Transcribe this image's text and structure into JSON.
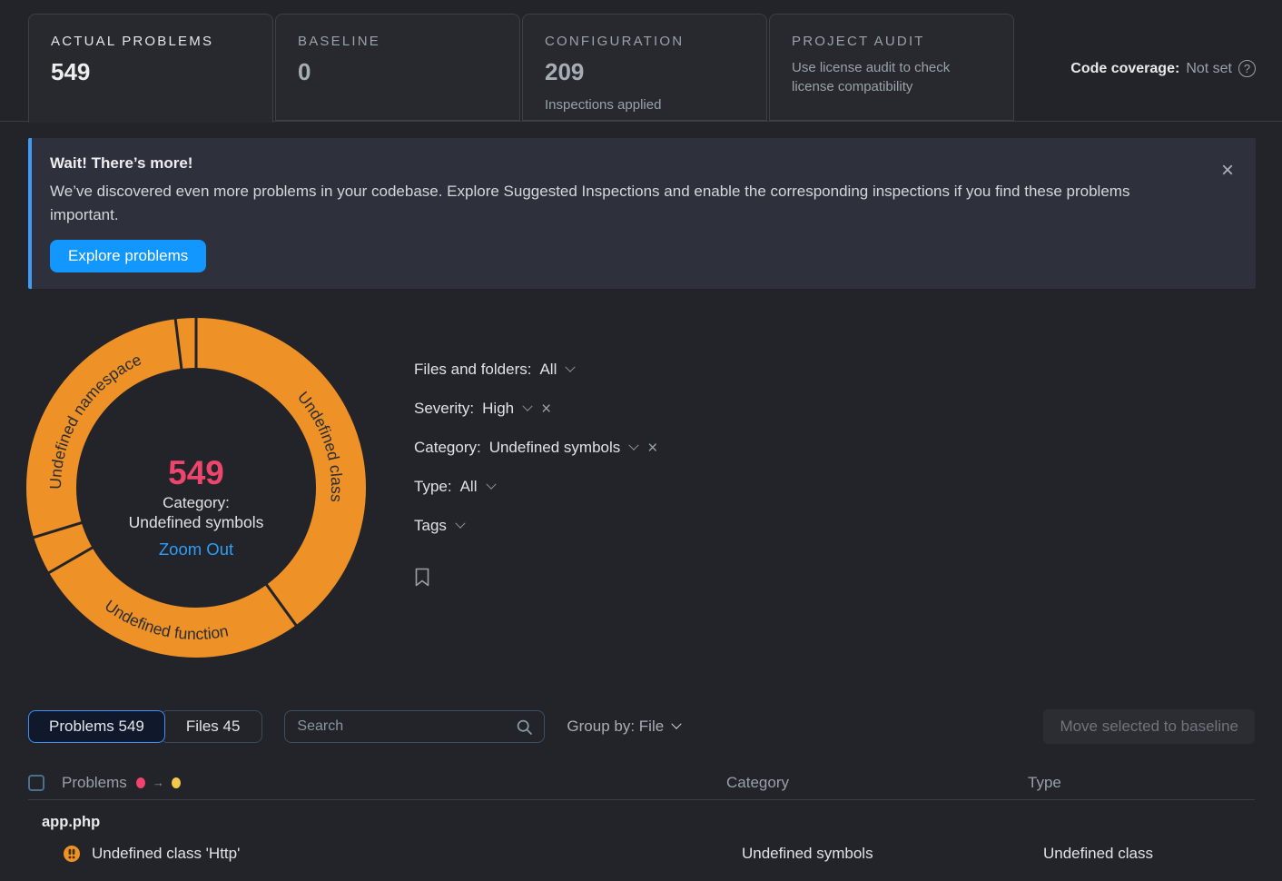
{
  "header": {
    "tabs": [
      {
        "label": "ACTUAL PROBLEMS",
        "value": "549"
      },
      {
        "label": "BASELINE",
        "value": "0"
      },
      {
        "label": "CONFIGURATION",
        "value": "209",
        "description": "Inspections applied"
      },
      {
        "label": "PROJECT AUDIT",
        "description": "Use license audit to check license compatibility"
      }
    ],
    "code_coverage": {
      "label": "Code coverage:",
      "value": "Not set",
      "help_icon": "?"
    }
  },
  "banner": {
    "title": "Wait! There’s more!",
    "body": "We’ve discovered even more problems in your codebase. Explore Suggested Inspections and enable the corresponding inspections if you find these problems important.",
    "button": "Explore problems",
    "close_icon": "×"
  },
  "chart_data": {
    "type": "donut",
    "unit": "problems",
    "total": 549,
    "segments": [
      {
        "label": "Undefined class",
        "value": 220,
        "start_deg": 0,
        "end_deg": 144
      },
      {
        "label": "Undefined function",
        "value": 146,
        "start_deg": 144,
        "end_deg": 240
      },
      {
        "label": "",
        "value": 20,
        "start_deg": 240,
        "end_deg": 253
      },
      {
        "label": "Undefined namespace",
        "value": 152,
        "start_deg": 253,
        "end_deg": 353
      },
      {
        "label": "",
        "value": 11,
        "start_deg": 353,
        "end_deg": 360
      }
    ],
    "center": {
      "value": "549",
      "label_line1": "Category:",
      "label_line2": "Undefined symbols",
      "link": "Zoom Out"
    },
    "colors": {
      "ring": "#ee9126",
      "separator": "#222429",
      "segment_label": "#2b2d33",
      "center_value": "#ee456d",
      "center_label": "#dfe1e5",
      "link": "#2f9df5"
    }
  },
  "filters": {
    "items": [
      {
        "label": "Files and folders:",
        "value": "All"
      },
      {
        "label": "Severity:",
        "value": "High"
      },
      {
        "label": "Category:",
        "value": "Undefined symbols"
      },
      {
        "label": "Type:",
        "value": "All"
      },
      {
        "label": "Tags",
        "value": ""
      }
    ],
    "clear_icon": "×"
  },
  "toolbar": {
    "view_tabs": [
      {
        "label": "Problems 549"
      },
      {
        "label": "Files 45"
      }
    ],
    "search_placeholder": "Search",
    "group_by": "Group by: File",
    "move_button": "Move selected to baseline"
  },
  "table": {
    "columns": {
      "problems": "Problems",
      "category": "Category",
      "type": "Type"
    },
    "legend": {
      "from_color": "#f0436e",
      "arrow": "→",
      "to_color": "#f2c94c"
    },
    "group": "app.php",
    "rows": [
      {
        "severity": "high",
        "problem": "Undefined class 'Http'",
        "category": "Undefined symbols",
        "type": "Undefined class"
      }
    ]
  },
  "colors": {
    "accent_blue": "#1197fd",
    "selected_tab_border": "#3f8ef6",
    "severity_high": "#ee9126",
    "page_background": "#222429",
    "card_background": "#27292e",
    "banner_background": "#2e313c"
  }
}
